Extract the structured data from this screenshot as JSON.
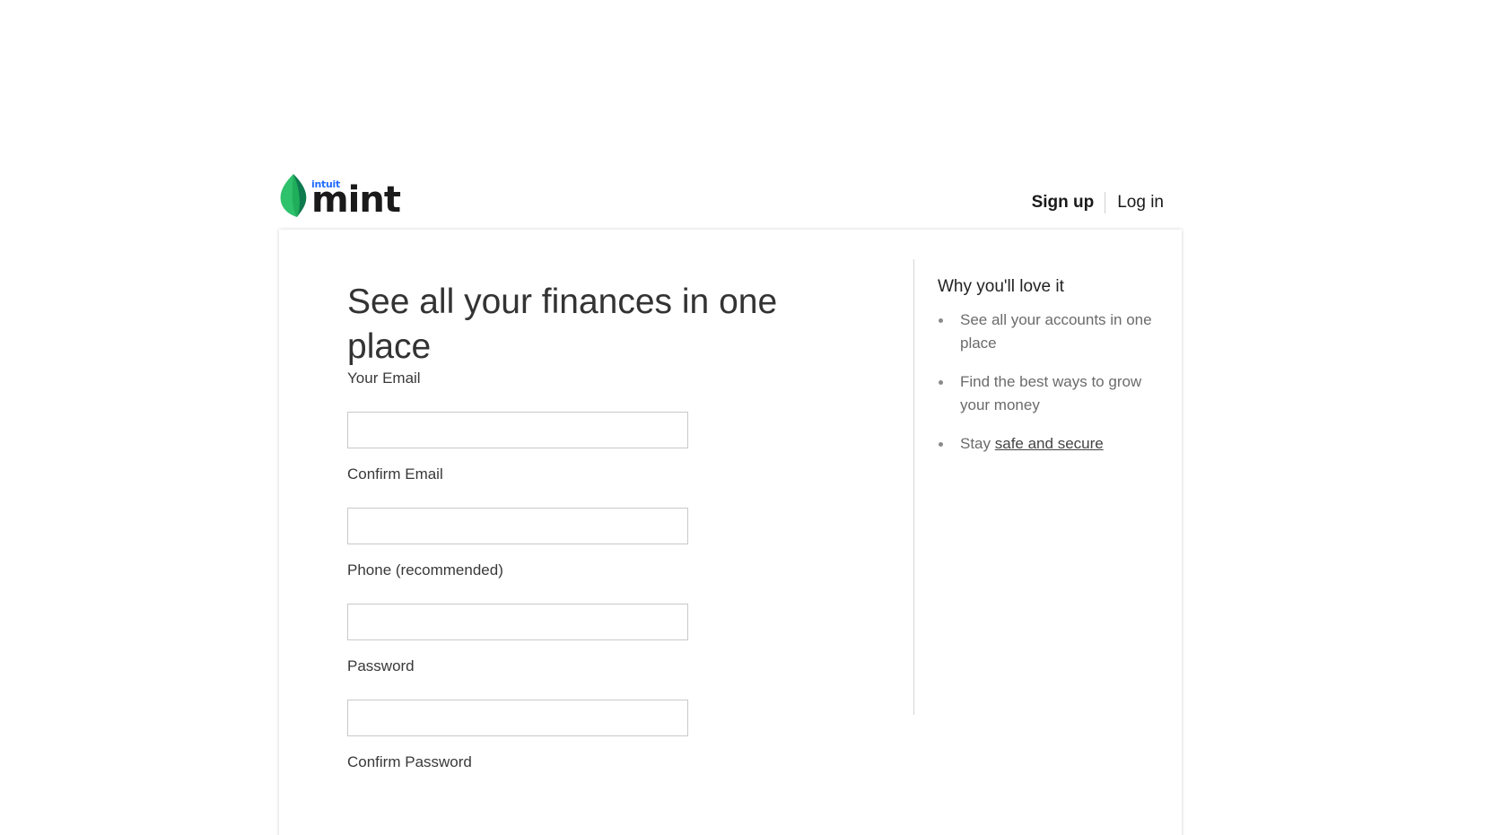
{
  "header": {
    "logo_brand": "mint",
    "logo_parent": "intuit",
    "nav": {
      "signup_label": "Sign up",
      "login_label": "Log in"
    }
  },
  "form": {
    "title": "See all your finances in one place",
    "fields": [
      {
        "label": "Your Email",
        "value": "",
        "placeholder": ""
      },
      {
        "label": "Confirm Email",
        "value": "",
        "placeholder": ""
      },
      {
        "label": "Phone (recommended)",
        "value": "",
        "placeholder": ""
      },
      {
        "label": "Password",
        "value": "",
        "placeholder": ""
      },
      {
        "label": "Confirm Password"
      }
    ]
  },
  "sidebar": {
    "title": "Why you'll love it",
    "items": [
      {
        "text": "See all your accounts in one place"
      },
      {
        "text": "Find the best ways to grow your money"
      },
      {
        "prefix": "Stay ",
        "link": "safe and secure"
      }
    ]
  },
  "colors": {
    "brand_green": "#2dc26b",
    "brand_dark_green": "#0e7a4e",
    "intuit_blue": "#236cff",
    "text_dark": "#333333",
    "text_muted": "#6b6b6b"
  },
  "icons": {
    "logo_leaf": "mint-leaf-icon"
  }
}
